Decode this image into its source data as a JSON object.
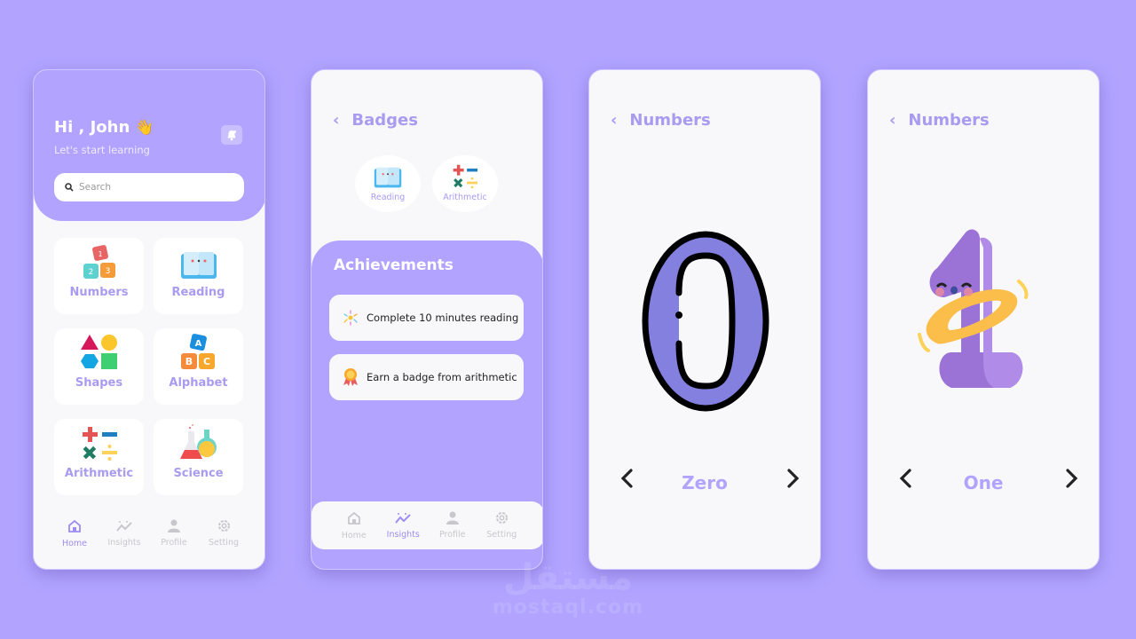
{
  "home": {
    "greeting": "Hi , John",
    "wave_icon": "waving-hand-icon",
    "subtitle": "Let's start learning",
    "search_placeholder": "Search",
    "categories": [
      {
        "label": "Numbers",
        "icon": "number-blocks-icon"
      },
      {
        "label": "Reading",
        "icon": "book-icon"
      },
      {
        "label": "Shapes",
        "icon": "shapes-icon"
      },
      {
        "label": "Alphabet",
        "icon": "abc-blocks-icon"
      },
      {
        "label": "Arithmetic",
        "icon": "math-operators-icon"
      },
      {
        "label": "Science",
        "icon": "flask-icon"
      }
    ],
    "nav": [
      {
        "label": "Home",
        "active": true
      },
      {
        "label": "Insights",
        "active": false
      },
      {
        "label": "Profile",
        "active": false
      },
      {
        "label": "Setting",
        "active": false
      }
    ]
  },
  "badges_screen": {
    "title": "Badges",
    "badges": [
      {
        "label": "Reading",
        "icon": "book-icon"
      },
      {
        "label": "Arithmetic",
        "icon": "math-operators-icon"
      }
    ],
    "achievements_title": "Achievements",
    "achievements": [
      {
        "text": "Complete 10 minutes reading",
        "icon": "fireworks-icon"
      },
      {
        "text": "Earn a badge from arithmetic",
        "icon": "medal-icon"
      }
    ],
    "nav": [
      {
        "label": "Home",
        "active": false
      },
      {
        "label": "Insights",
        "active": true
      },
      {
        "label": "Profile",
        "active": false
      },
      {
        "label": "Setting",
        "active": false
      }
    ]
  },
  "number_screens": [
    {
      "title": "Numbers",
      "digit": "0",
      "label": "Zero"
    },
    {
      "title": "Numbers",
      "digit": "1",
      "label": "One"
    }
  ],
  "watermark": {
    "arabic": "مستقل",
    "latin": "mostaql.com"
  },
  "colors": {
    "background": "#b1a3ff",
    "accent": "#a99bf0",
    "card": "#f8f8fa",
    "digit_zero": "#8380e0",
    "digit_one": "#9b72d6"
  }
}
